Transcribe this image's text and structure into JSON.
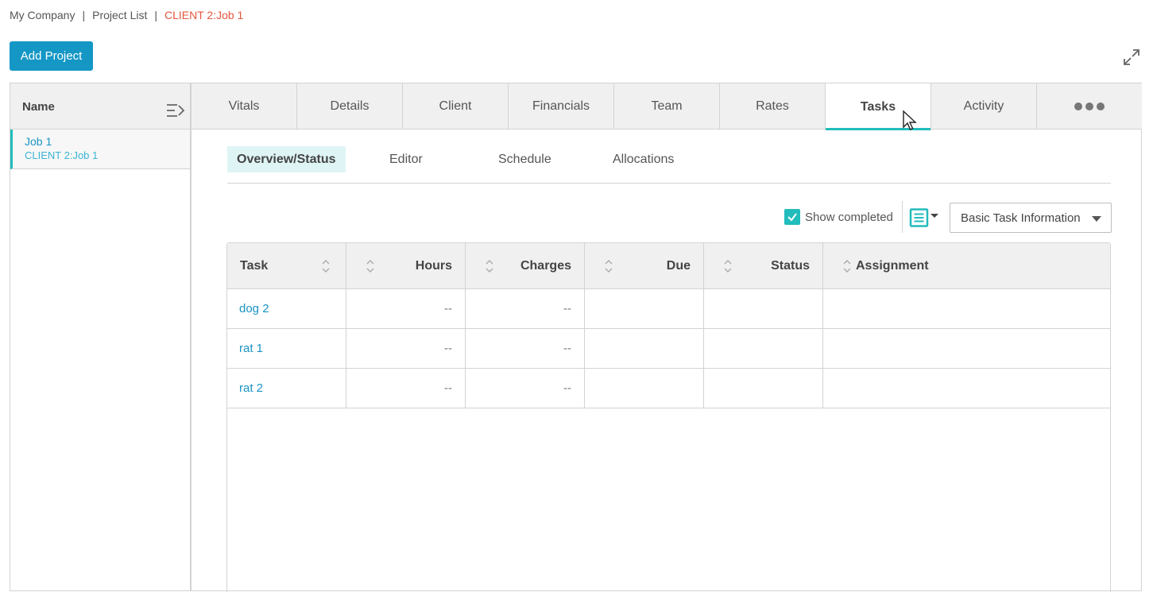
{
  "breadcrumb": {
    "company": "My Company",
    "separator": "|",
    "project_list": "Project List",
    "current": "CLIENT 2:Job 1"
  },
  "toolbar": {
    "add_project": "Add Project"
  },
  "icons": {
    "expand": "expand-icon",
    "collapse_panel": "collapse-panel-icon",
    "checkbox": "check-icon",
    "view_list": "list-view-icon",
    "sort": "sort-icon",
    "more": "more-dots-icon"
  },
  "left_panel": {
    "header": "Name",
    "projects": [
      {
        "title": "Job 1",
        "subtitle": "CLIENT 2:Job 1"
      }
    ]
  },
  "tabs": [
    "Vitals",
    "Details",
    "Client",
    "Financials",
    "Team",
    "Rates",
    "Tasks",
    "Activity"
  ],
  "active_tab": "Tasks",
  "subtabs": [
    "Overview/Status",
    "Editor",
    "Schedule",
    "Allocations"
  ],
  "active_subtab": "Overview/Status",
  "options": {
    "show_completed_label": "Show completed",
    "show_completed_checked": true,
    "view_select": "Basic Task Information"
  },
  "table": {
    "columns": [
      "Task",
      "Hours",
      "Charges",
      "Due",
      "Status",
      "Assignment"
    ],
    "rows": [
      {
        "task": "dog 2",
        "hours": "--",
        "charges": "--",
        "due": "",
        "status": "",
        "assignment": ""
      },
      {
        "task": "rat 1",
        "hours": "--",
        "charges": "--",
        "due": "",
        "status": "",
        "assignment": ""
      },
      {
        "task": "rat 2",
        "hours": "--",
        "charges": "--",
        "due": "",
        "status": "",
        "assignment": ""
      }
    ]
  },
  "colors": {
    "accent": "#22bcbc",
    "primary_button": "#1497c5",
    "link": "#1a94c3",
    "breadcrumb_current": "#e4563d"
  }
}
